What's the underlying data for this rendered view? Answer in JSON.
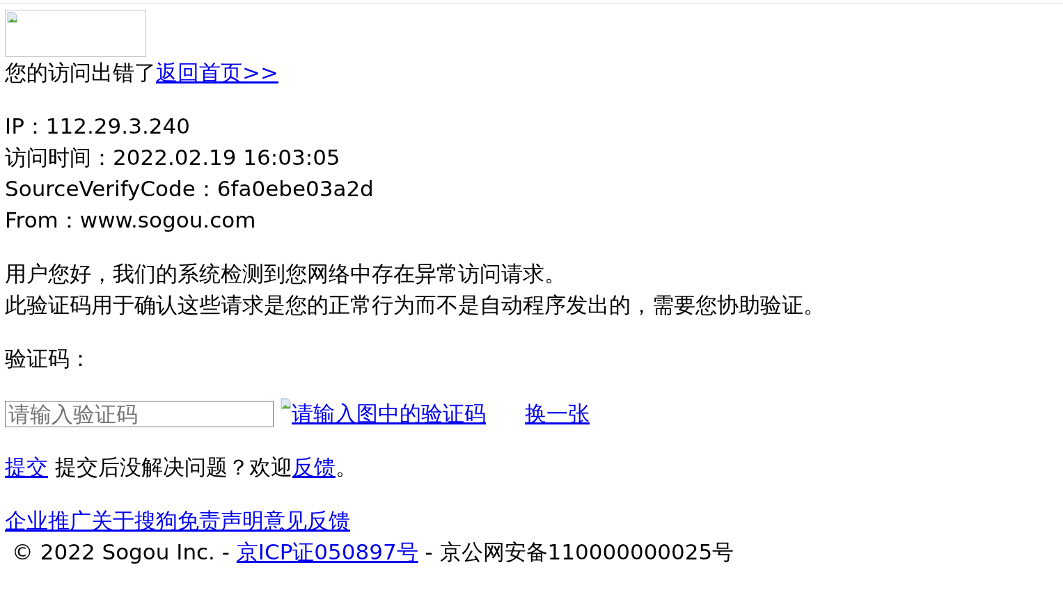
{
  "error": {
    "message": "您的访问出错了",
    "home_link": "返回首页>>"
  },
  "info": [
    "IP：112.29.3.240",
    "访问时间：2022.02.19 16:03:05",
    "SourceVerifyCode：6fa0ebe03a2d",
    "From：www.sogou.com"
  ],
  "notice": [
    "用户您好，我们的系统检测到您网络中存在异常访问请求。",
    "此验证码用于确认这些请求是您的正常行为而不是自动程序发出的，需要您协助验证。"
  ],
  "captcha": {
    "label": "验证码：",
    "input": {
      "placeholder": "请输入验证码"
    },
    "image_alt": "请输入图中的验证码",
    "refresh_link": "换一张"
  },
  "submit": {
    "link": "提交",
    "text": "提交后没解决问题？欢迎",
    "feedback_link": "反馈",
    "end": "。"
  },
  "footer_links": [
    "企业推广",
    "关于搜狗",
    "免责声明",
    "意见反馈"
  ],
  "copyright": {
    "prefix": "© 2022 Sogou Inc. - ",
    "icp_link": "京ICP证050897号",
    "suffix": " - 京公网安备110000000025号"
  }
}
